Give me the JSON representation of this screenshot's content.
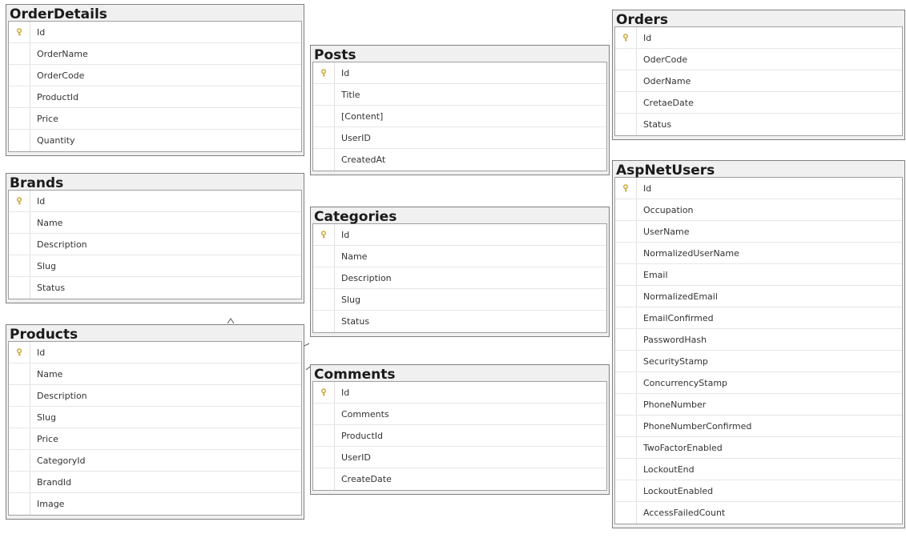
{
  "tables": {
    "orderdetails": {
      "name": "OrderDetails",
      "primary_key": "Id",
      "columns": [
        "OrderName",
        "OrderCode",
        "ProductId",
        "Price",
        "Quantity"
      ]
    },
    "brands": {
      "name": "Brands",
      "primary_key": "Id",
      "columns": [
        "Name",
        "Description",
        "Slug",
        "Status"
      ]
    },
    "products": {
      "name": "Products",
      "primary_key": "Id",
      "columns": [
        "Name",
        "Description",
        "Slug",
        "Price",
        "CategoryId",
        "BrandId",
        "Image"
      ]
    },
    "posts": {
      "name": "Posts",
      "primary_key": "Id",
      "columns": [
        "Title",
        "[Content]",
        "UserID",
        "CreatedAt"
      ]
    },
    "categories": {
      "name": "Categories",
      "primary_key": "Id",
      "columns": [
        "Name",
        "Description",
        "Slug",
        "Status"
      ]
    },
    "comments": {
      "name": "Comments",
      "primary_key": "Id",
      "columns": [
        "Comments",
        "ProductId",
        "UserID",
        "CreateDate"
      ]
    },
    "orders": {
      "name": "Orders",
      "primary_key": "Id",
      "columns": [
        "OderCode",
        "OderName",
        "CretaeDate",
        "Status"
      ]
    },
    "aspnetusers": {
      "name": "AspNetUsers",
      "primary_key": "Id",
      "columns": [
        "Occupation",
        "UserName",
        "NormalizedUserName",
        "Email",
        "NormalizedEmail",
        "EmailConfirmed",
        "PasswordHash",
        "SecurityStamp",
        "ConcurrencyStamp",
        "PhoneNumber",
        "PhoneNumberConfirmed",
        "TwoFactorEnabled",
        "LockoutEnd",
        "LockoutEnabled",
        "AccessFailedCount"
      ]
    }
  },
  "key_icon": "primary-key-icon",
  "colors": {
    "key": "#c9a227",
    "border": "#808080",
    "header_bg": "#f0f0f0"
  }
}
